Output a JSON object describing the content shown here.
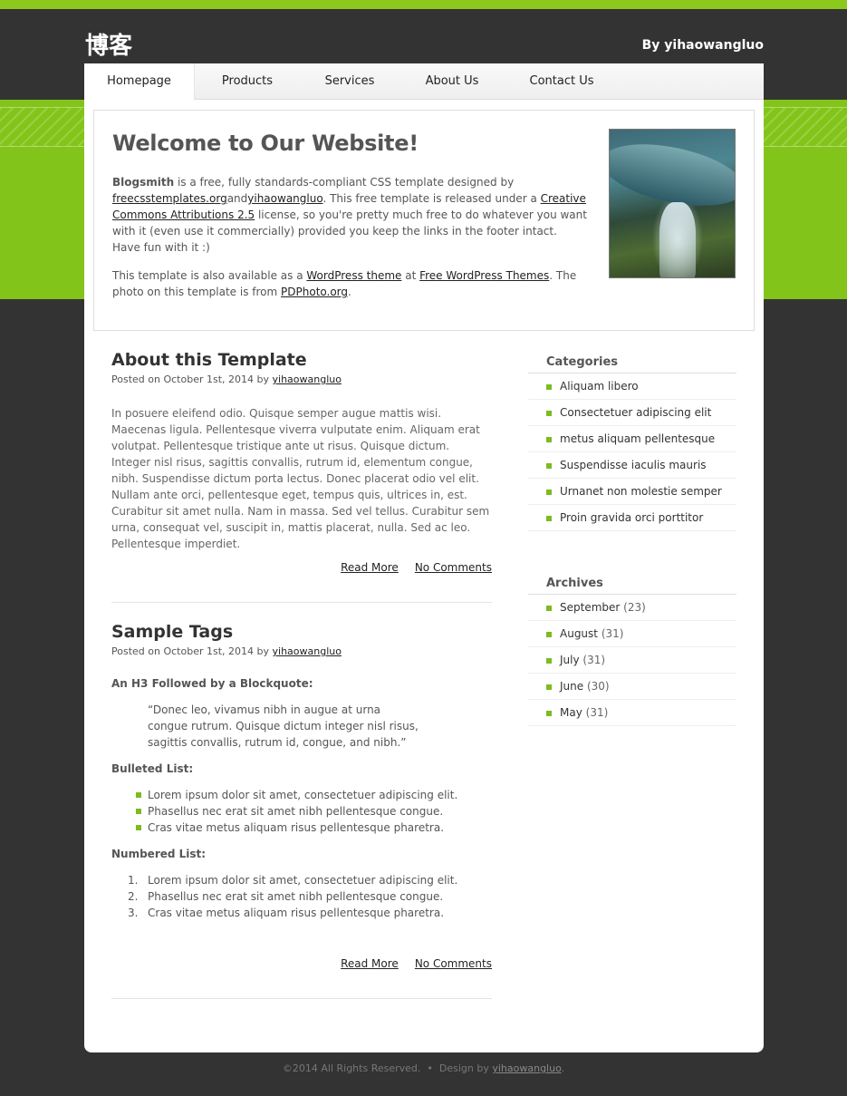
{
  "header": {
    "logo": "博客",
    "byline": "By yihaowangluo"
  },
  "nav": [
    {
      "label": "Homepage",
      "active": true
    },
    {
      "label": "Products"
    },
    {
      "label": "Services"
    },
    {
      "label": "About Us"
    },
    {
      "label": "Contact Us"
    }
  ],
  "welcome": {
    "title": "Welcome to Our Website!",
    "intro_bold": "Blogsmith",
    "intro_1": " is a free, fully standards-compliant CSS template designed by ",
    "link_freecss": "freecsstemplates.org",
    "and": "and",
    "link_author": "yihaowangluo",
    "intro_2": ". This free template is released under a ",
    "link_cc": "Creative Commons Attributions 2.5",
    "intro_3": " license, so you're pretty much free to do whatever you want with it (even use it commercially) provided you keep the links in the footer intact. Have fun with it :)",
    "p2_1": "This template is also available as a ",
    "link_wp": "WordPress theme",
    "p2_2": " at ",
    "link_wpt": "Free WordPress Themes",
    "p2_3": ". The photo on this template is from ",
    "link_pd": "PDPhoto.org",
    "p2_4": "."
  },
  "posts": [
    {
      "title": "About this Template",
      "meta_prefix": "Posted on October 1st, 2014 by ",
      "author": "yihaowangluo",
      "body": "In posuere eleifend odio. Quisque semper augue mattis wisi. Maecenas ligula. Pellentesque viverra vulputate enim. Aliquam erat volutpat. Pellentesque tristique ante ut risus. Quisque dictum. Integer nisl risus, sagittis convallis, rutrum id, elementum congue, nibh. Suspendisse dictum porta lectus. Donec placerat odio vel elit. Nullam ante orci, pellentesque eget, tempus quis, ultrices in, est. Curabitur sit amet nulla. Nam in massa. Sed vel tellus. Curabitur sem urna, consequat vel, suscipit in, mattis placerat, nulla. Sed ac leo. Pellentesque imperdiet.",
      "read_more": "Read More",
      "comments": "No Comments"
    },
    {
      "title": "Sample Tags",
      "meta_prefix": "Posted on October 1st, 2014 by ",
      "author": "yihaowangluo",
      "h3_quote": "An H3 Followed by a Blockquote:",
      "quote": "“Donec leo, vivamus nibh in augue at urna congue rutrum. Quisque dictum integer nisl risus, sagittis convallis, rutrum id, congue, and nibh.”",
      "h3_bullets": "Bulleted List:",
      "bullets": [
        "Lorem ipsum dolor sit amet, consectetuer adipiscing elit.",
        "Phasellus nec erat sit amet nibh pellentesque congue.",
        "Cras vitae metus aliquam risus pellentesque pharetra."
      ],
      "h3_numbered": "Numbered List:",
      "numbered": [
        "Lorem ipsum dolor sit amet, consectetuer adipiscing elit.",
        "Phasellus nec erat sit amet nibh pellentesque congue.",
        "Cras vitae metus aliquam risus pellentesque pharetra."
      ],
      "read_more": "Read More",
      "comments": "No Comments"
    }
  ],
  "sidebar": {
    "categories_title": "Categories",
    "categories": [
      "Aliquam libero",
      "Consectetuer adipiscing elit",
      "metus aliquam pellentesque",
      "Suspendisse iaculis mauris",
      "Urnanet non molestie semper",
      "Proin gravida orci porttitor"
    ],
    "archives_title": "Archives",
    "archives": [
      {
        "month": "September",
        "count": "(23)"
      },
      {
        "month": "August",
        "count": "(31)"
      },
      {
        "month": "July",
        "count": "(31)"
      },
      {
        "month": "June",
        "count": "(30)"
      },
      {
        "month": "May",
        "count": "(31)"
      }
    ]
  },
  "footer": {
    "copyright": "©2014 All Rights Reserved.",
    "sep": "•",
    "design_prefix": "Design by ",
    "design_link": "yihaowangluo",
    "end": "."
  },
  "colors": {
    "accent": "#83c41a",
    "background": "#333333",
    "bullet": "#7dbb1f"
  }
}
